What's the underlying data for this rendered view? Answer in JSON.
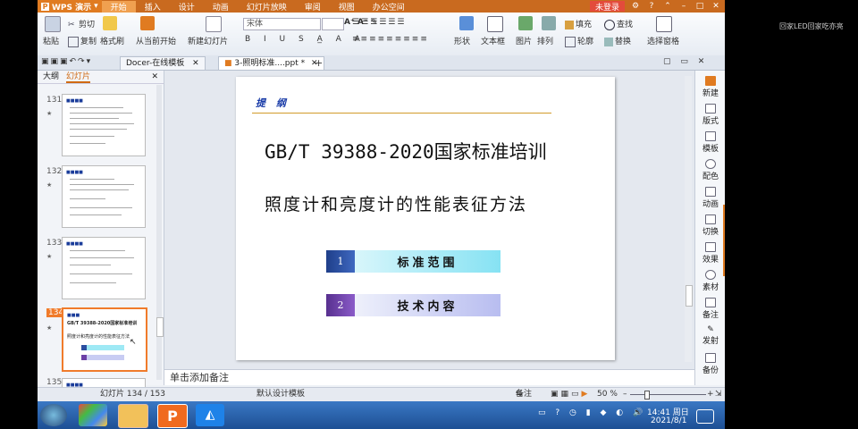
{
  "menubar": {
    "app_name": "WPS 演示",
    "items": [
      "开始",
      "插入",
      "设计",
      "动画",
      "幻灯片放映",
      "审阅",
      "视图",
      "办公空间"
    ],
    "login": "未登录"
  },
  "ribbon": {
    "paste": "粘贴",
    "cut": "剪切",
    "copy": "复制",
    "format_painter": "格式刷",
    "from_current": "从当前开始",
    "new_slide": "新建幻灯片",
    "font_name": "宋体",
    "font_size": "",
    "shape": "形状",
    "textbox": "文本框",
    "picture": "图片",
    "arrange": "排列",
    "fill": "填充",
    "outline": "轮廓",
    "find": "查找",
    "replace": "替换",
    "select_pane": "选择窗格"
  },
  "tabs": [
    {
      "label": "Docer-在线模板"
    },
    {
      "label": "3-照明标准....ppt *"
    }
  ],
  "left_panel": {
    "tab_outline": "大纲",
    "tab_slides": "幻灯片",
    "slides": [
      {
        "num": "131"
      },
      {
        "num": "132"
      },
      {
        "num": "133"
      },
      {
        "num": "134",
        "title": "GB/T 39388-2020国家标准培训",
        "subtitle": "照度计和亮度计的性能表征方法"
      },
      {
        "num": "135"
      }
    ]
  },
  "slide": {
    "heading": "提 纲",
    "title": "GB/T 39388-2020国家标准培训",
    "subtitle": "照度计和亮度计的性能表征方法",
    "items": [
      {
        "num": "1",
        "label": "标准范围"
      },
      {
        "num": "2",
        "label": "技术内容"
      }
    ],
    "colors": {
      "item1_num_bg": "#2b4ea0",
      "item1_label_bg": "#9ee9f5",
      "item2_num_bg": "#6b3fa6",
      "item2_label_bg": "#c8ccf3",
      "heading_line": "#d29b2a"
    }
  },
  "right_toolbar": [
    "新建",
    "版式",
    "模板",
    "配色",
    "动画",
    "切换",
    "效果",
    "素材",
    "备注",
    "发射",
    "备份"
  ],
  "notes_placeholder": "单击添加备注",
  "status": {
    "slide_counter": "幻灯片 134 / 153",
    "design_template": "默认设计模板",
    "notes_btn": "备注",
    "zoom": "50 %"
  },
  "taskbar": {
    "time": "14:41 周日",
    "date": "2021/8/1"
  },
  "watermark": "回家LED回家吃亦亮"
}
